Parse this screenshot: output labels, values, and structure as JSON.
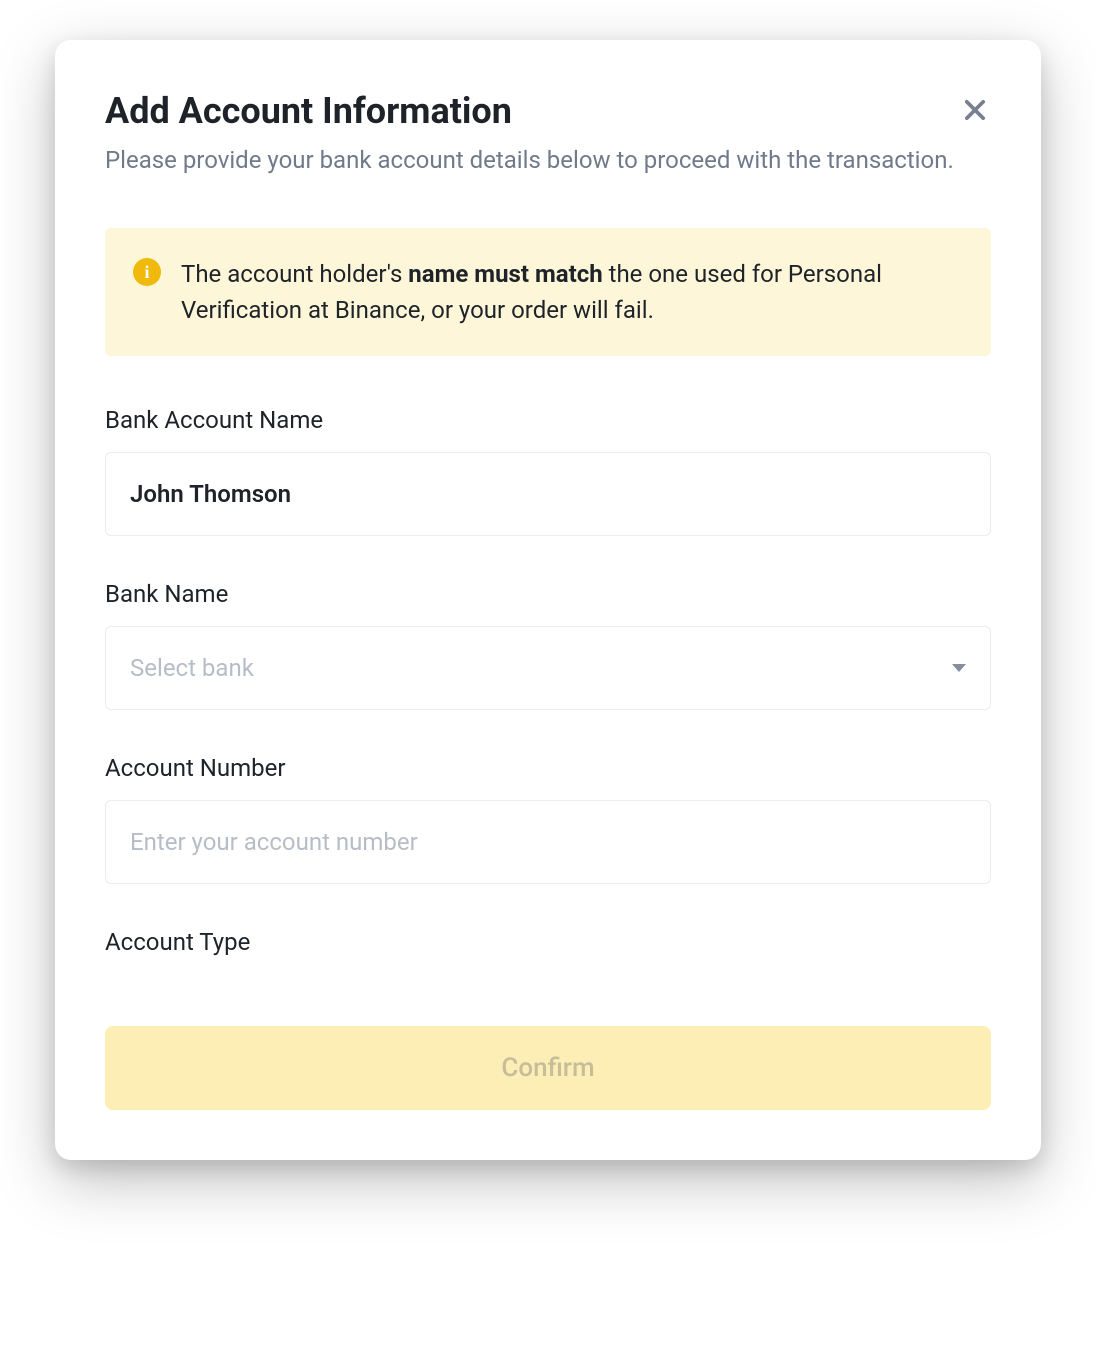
{
  "modal": {
    "title": "Add Account Information",
    "subtitle": "Please provide your bank account details below to proceed with the transaction.",
    "warning": {
      "prefix": "The account holder's ",
      "bold": "name must match",
      "suffix": " the one used for Personal Verification at Binance, or your order will fail."
    },
    "fields": {
      "bank_account_name": {
        "label": "Bank Account Name",
        "value": "John Thomson"
      },
      "bank_name": {
        "label": "Bank Name",
        "placeholder": "Select bank"
      },
      "account_number": {
        "label": "Account Number",
        "placeholder": "Enter your account number"
      },
      "account_type": {
        "label": "Account Type"
      }
    },
    "confirm_label": "Confirm"
  }
}
